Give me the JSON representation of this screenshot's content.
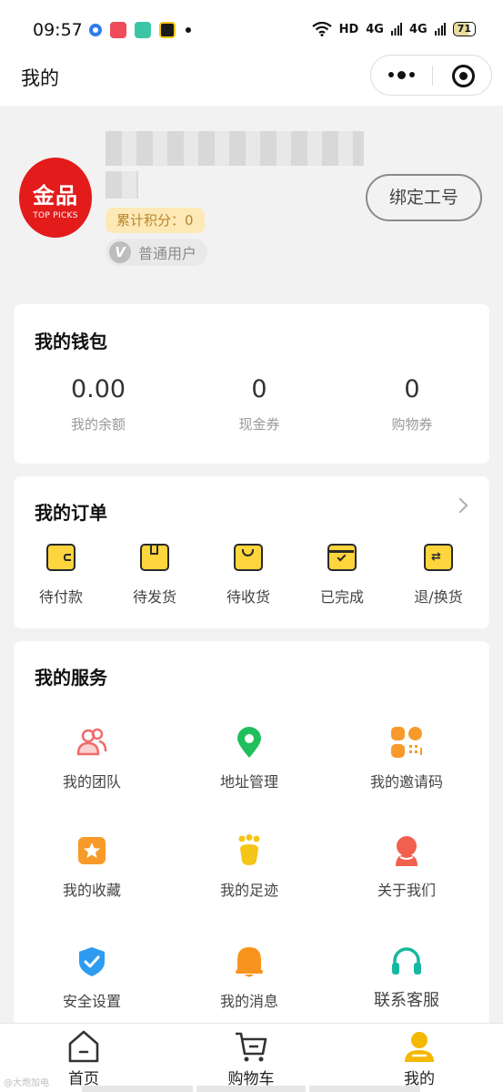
{
  "status_bar": {
    "time": "09:57",
    "network": "HD",
    "signal1": "4G",
    "signal2": "4G",
    "battery": "71"
  },
  "header": {
    "title": "我的"
  },
  "profile": {
    "logo_cn": "金品",
    "logo_en": "TOP PICKS",
    "points_label": "累计积分：0",
    "member_level": "普通用户",
    "member_icon_letter": "V",
    "bind_button": "绑定工号"
  },
  "wallet": {
    "title": "我的钱包",
    "items": [
      {
        "value": "0.00",
        "label": "我的余额"
      },
      {
        "value": "0",
        "label": "现金券"
      },
      {
        "value": "0",
        "label": "购物券"
      }
    ]
  },
  "orders": {
    "title": "我的订单",
    "items": [
      {
        "label": "待付款",
        "icon": "wallet-icon"
      },
      {
        "label": "待发货",
        "icon": "package-icon"
      },
      {
        "label": "待收货",
        "icon": "shopping-bag-icon"
      },
      {
        "label": "已完成",
        "icon": "completed-box-icon"
      },
      {
        "label": "退/换货",
        "icon": "exchange-icon"
      }
    ]
  },
  "services": {
    "title": "我的服务",
    "items": [
      {
        "label": "我的团队",
        "icon": "team-icon",
        "color": "#f06b6b"
      },
      {
        "label": "地址管理",
        "icon": "location-pin-icon",
        "color": "#1fbf5c"
      },
      {
        "label": "我的邀请码",
        "icon": "qr-code-icon",
        "color": "#f79a2a"
      },
      {
        "label": "我的收藏",
        "icon": "star-icon",
        "color": "#f79a2a"
      },
      {
        "label": "我的足迹",
        "icon": "footprint-icon",
        "color": "#f5c518"
      },
      {
        "label": "关于我们",
        "icon": "person-icon",
        "color": "#f0604d"
      },
      {
        "label": "安全设置",
        "icon": "shield-icon",
        "color": "#2d9cf0"
      },
      {
        "label": "我的消息",
        "icon": "bell-icon",
        "color": "#f7941d"
      },
      {
        "label": "联系客服",
        "icon": "headset-icon",
        "color": "#16b8a0"
      }
    ]
  },
  "tabbar": {
    "items": [
      {
        "label": "首页",
        "icon": "home-icon"
      },
      {
        "label": "购物车",
        "icon": "cart-icon"
      },
      {
        "label": "我的",
        "icon": "profile-icon"
      }
    ]
  },
  "watermark": "@大炮加电",
  "colors": {
    "brand_red": "#e31b1b",
    "accent_yellow": "#ffd53d",
    "points_bg": "#fde9b6",
    "points_text": "#b9852c"
  }
}
